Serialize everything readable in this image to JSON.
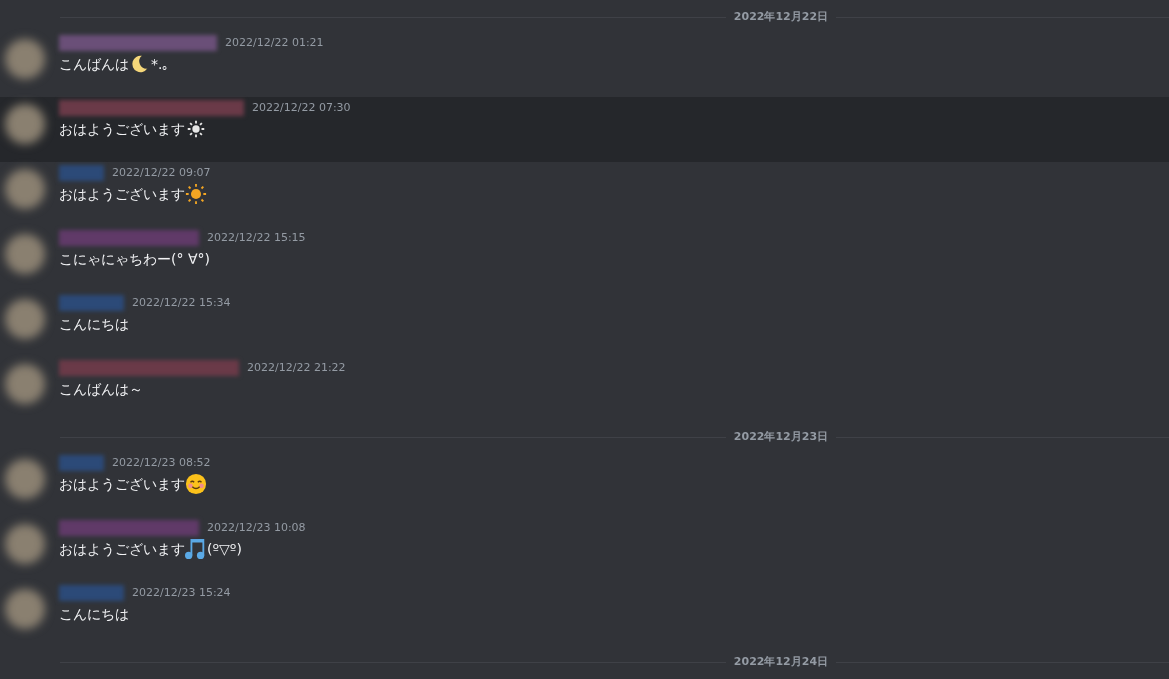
{
  "timeline": [
    {
      "kind": "divider",
      "date": "2022年12月22日"
    },
    {
      "kind": "message",
      "color": "#6a4f78",
      "highlighted": false,
      "time": "2022/12/22 01:21",
      "parts": [
        {
          "kind": "text",
          "text": "こんばんは"
        },
        {
          "kind": "moon"
        },
        {
          "kind": "text",
          "text": "*.｡"
        }
      ]
    },
    {
      "kind": "message",
      "color": "#6a3a48",
      "highlighted": true,
      "time": "2022/12/22 07:30",
      "parts": [
        {
          "kind": "text",
          "text": "おはようございます"
        },
        {
          "kind": "sun-small"
        }
      ]
    },
    {
      "kind": "message",
      "color": "#2c4a78",
      "highlighted": false,
      "time": "2022/12/22 09:07",
      "parts": [
        {
          "kind": "text",
          "text": "おはようございます"
        },
        {
          "kind": "sun"
        }
      ]
    },
    {
      "kind": "message",
      "color": "#603a68",
      "highlighted": false,
      "time": "2022/12/22 15:15",
      "parts": [
        {
          "kind": "text",
          "text": "こにゃにゃちわー(° ∀°)"
        }
      ]
    },
    {
      "kind": "message",
      "color": "#2c4a78",
      "highlighted": false,
      "time": "2022/12/22 15:34",
      "parts": [
        {
          "kind": "text",
          "text": "こんにちは"
        }
      ]
    },
    {
      "kind": "message",
      "color": "#6a3a48",
      "highlighted": false,
      "time": "2022/12/22 21:22",
      "parts": [
        {
          "kind": "text",
          "text": "こんばんは～"
        }
      ]
    },
    {
      "kind": "divider",
      "date": "2022年12月23日"
    },
    {
      "kind": "message",
      "color": "#2c4a78",
      "highlighted": false,
      "time": "2022/12/23 08:52",
      "parts": [
        {
          "kind": "text",
          "text": "おはようございます"
        },
        {
          "kind": "smile"
        }
      ]
    },
    {
      "kind": "message",
      "color": "#603a68",
      "highlighted": false,
      "time": "2022/12/23 10:08",
      "parts": [
        {
          "kind": "text",
          "text": "おはようございます"
        },
        {
          "kind": "notes"
        },
        {
          "kind": "text",
          "text": "(º▽º)"
        }
      ]
    },
    {
      "kind": "message",
      "color": "#2c4a78",
      "highlighted": false,
      "time": "2022/12/23 15:24",
      "parts": [
        {
          "kind": "text",
          "text": "こんにちは"
        }
      ]
    },
    {
      "kind": "divider",
      "date": "2022年12月24日"
    }
  ]
}
